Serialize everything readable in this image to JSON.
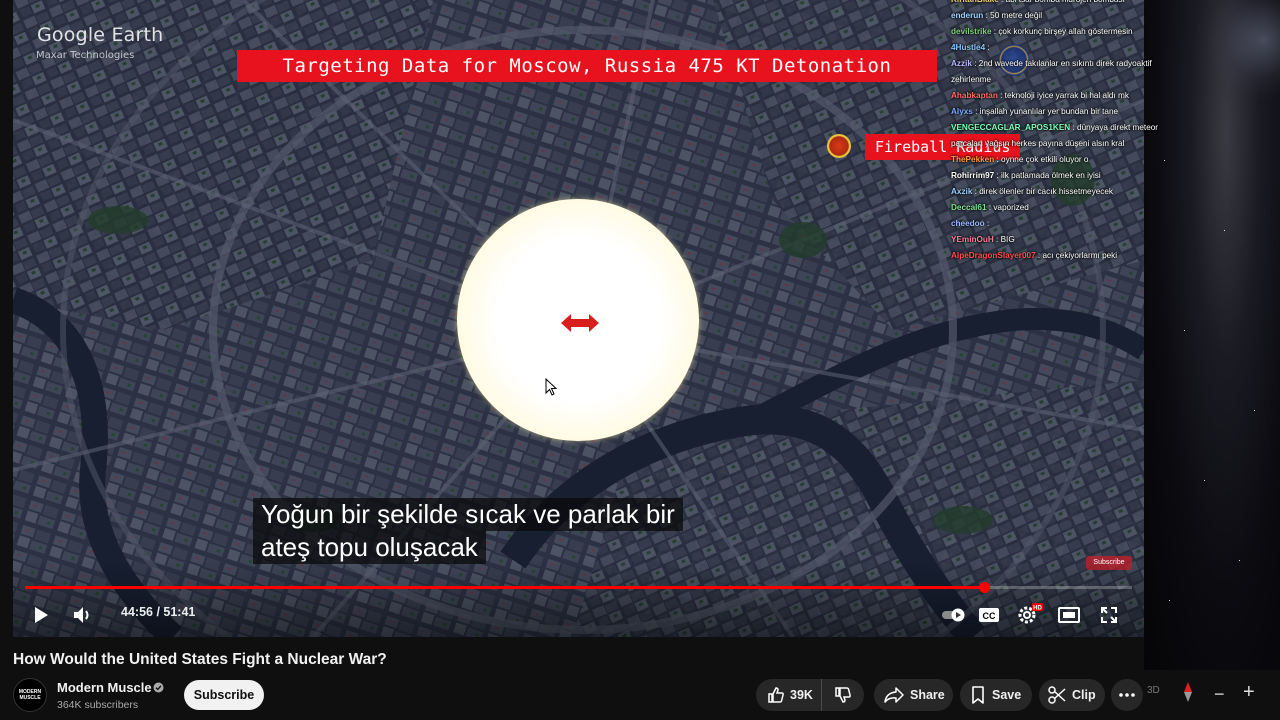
{
  "video": {
    "watermark_title": "Google Earth",
    "watermark_sub": "Maxar Technologies",
    "banner": "Targeting Data for Moscow, Russia 475 KT Detonation",
    "fireball_label": "Fireball Radius",
    "subtitle_line1": "Yoğun bir şekilde sıcak ve parlak bir",
    "subtitle_line2": "ateş topu oluşacak",
    "subscribe_watermark": "Subscribe",
    "progress_fraction": 0.8665
  },
  "player": {
    "time": "44:56 / 51:41",
    "icons": {
      "play": "play-icon",
      "volume": "volume-icon",
      "autoplay": "autoplay-toggle-icon",
      "captions": "captions-icon",
      "settings": "settings-gear-icon",
      "theater": "theater-mode-icon",
      "fullscreen": "fullscreen-icon"
    },
    "captions_label": "CC",
    "settings_badge": "HD"
  },
  "chat": [
    {
      "user": "KiritanBlake",
      "text": ": abi tsar bomba hidrojen bombası",
      "color": "#f5d27a"
    },
    {
      "user": "enderun",
      "text": ": 50 metre değil",
      "color": "#9fd3ff"
    },
    {
      "user": "devilstrike",
      "text": ": çok korkunç birşey allah göstermesin",
      "color": "#7fd17a"
    },
    {
      "user": "4Hustle4",
      "text": ":",
      "color": "#8ac6ff"
    },
    {
      "user": "Azzik",
      "text": ": 2nd wavede takılanlar en sıkıntı direk radyoaktif zehirlenme",
      "color": "#b7b7ff"
    },
    {
      "user": "Ahabkaptan",
      "text": ": teknoloji iyice yarrak bi hal aldı mk",
      "color": "#ff6a6a"
    },
    {
      "user": "Alyxs",
      "text": ": inşallah yunanlılar yer bundan bir tane",
      "color": "#7aa9ff"
    },
    {
      "user": "VENGECCAGLAR_APOS1KEN",
      "text": ": dünyaya direkt meteor parcaları yağsın herkes payına düşeni alsın kral",
      "color": "#7cffb2"
    },
    {
      "user": "ThePekken",
      "text": ": oynne çok etkili oluyor o",
      "color": "#ff9a3c"
    },
    {
      "user": "Rohirrim97",
      "text": ": ilk patlamada ölmek en iyisi",
      "color": "#ffffff"
    },
    {
      "user": "Axzik",
      "text": ": direk ölenler bir cacık hissetmeyecek",
      "color": "#9ad0ff"
    },
    {
      "user": "Deccal61",
      "text": ": vaporized",
      "color": "#7fe08a"
    },
    {
      "user": "cheedoo",
      "text": ":",
      "color": "#9ab8ff"
    },
    {
      "user": "YEminOuH",
      "text": ": BIG",
      "color": "#ff7b9b"
    },
    {
      "user": "AlpeDragonSlayer007",
      "text": ": acı çekiyorlarmı peki",
      "color": "#ff4d4d"
    }
  ],
  "below": {
    "title": "How Would the United States Fight a Nuclear War?",
    "channel_name": "Modern Muscle",
    "avatar_text": "MODERN MUSCLE",
    "subscribers": "364K subscribers",
    "subscribe_label": "Subscribe",
    "like_count": "39K",
    "share_label": "Share",
    "save_label": "Save",
    "clip_label": "Clip"
  },
  "map_controls": {
    "three_d": "3D",
    "zoom_out": "−",
    "zoom_in": "+"
  },
  "colors": {
    "banner_red": "#e8121e",
    "progress_red": "#ff0000",
    "fireball_yellow": "#fff4a8"
  }
}
